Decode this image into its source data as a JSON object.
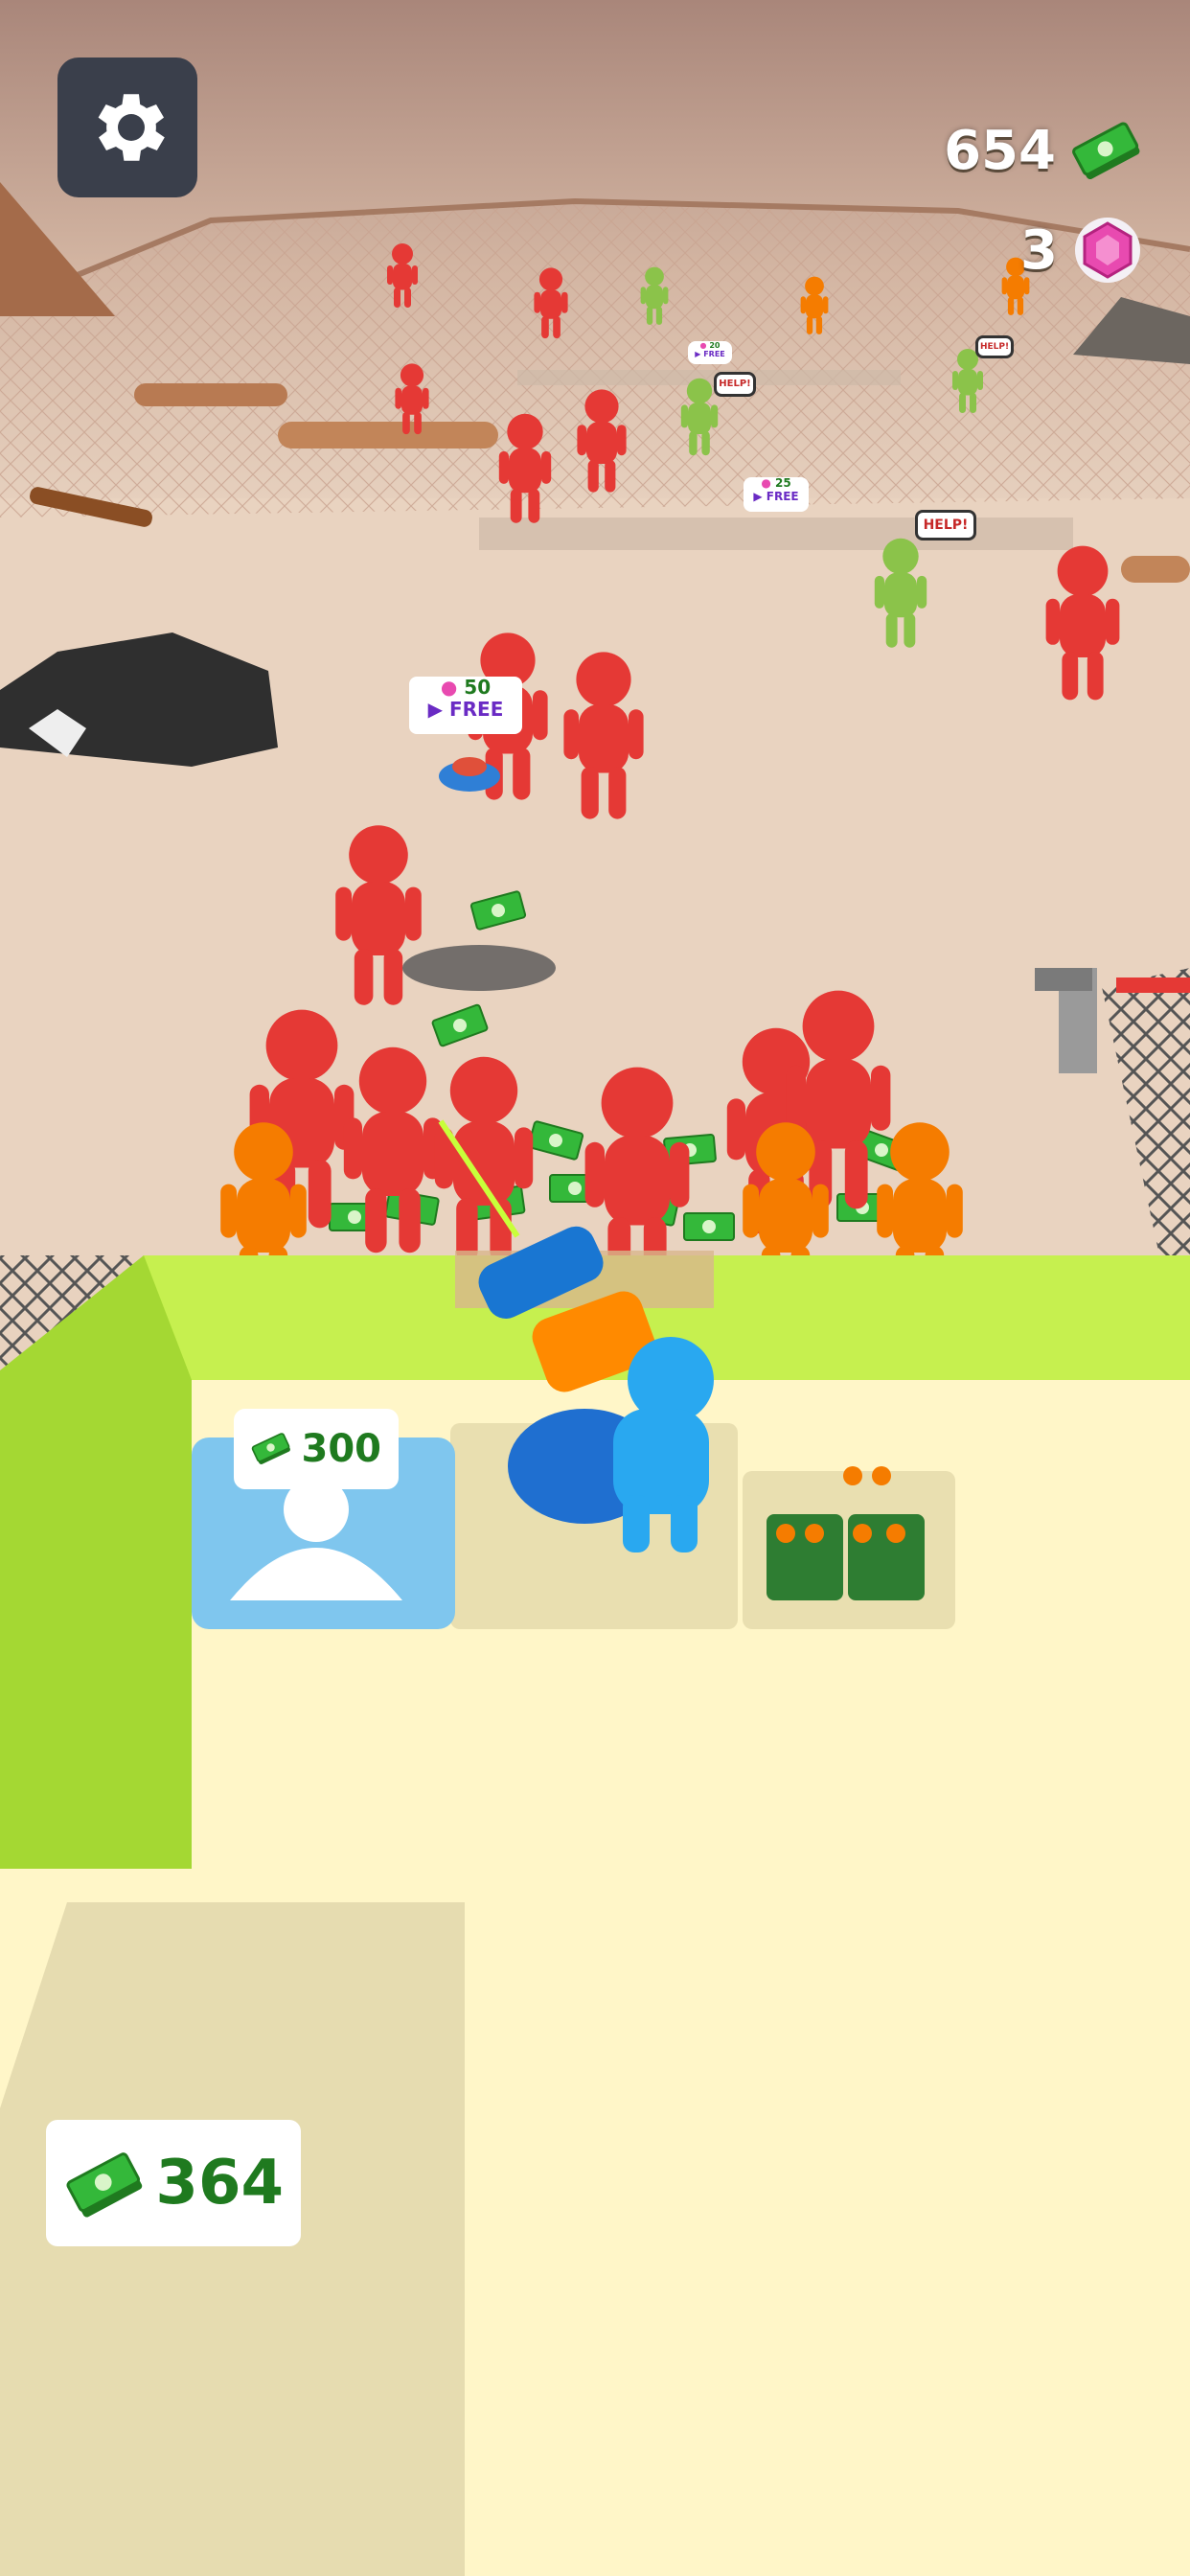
{
  "hud": {
    "cash": "654",
    "gems": "3",
    "settings_icon": "gear-icon",
    "cash_icon": "cash-stack-icon",
    "gem_icon": "pink-gem-icon"
  },
  "world": {
    "ad_offer_large": {
      "gems": "50",
      "label": "FREE",
      "icon": "play-video-icon"
    },
    "ad_offer_mid": {
      "gems": "25",
      "label": "FREE"
    },
    "ad_offer_small": {
      "gems": "20",
      "label": "FREE"
    },
    "help_label": "HELP!"
  },
  "base": {
    "recruit_price": "300",
    "cash_pile": "364"
  },
  "colors": {
    "enemy": "#e53935",
    "enemy_orange": "#f57c00",
    "hostage": "#8bc34a",
    "player": "#29a8f0",
    "wall_green": "#b5e83e",
    "floor": "#fff6c8",
    "gear_bg": "#3a3f4b",
    "cash_green": "#2e9e2e",
    "gem_pink": "#e84ab0"
  }
}
